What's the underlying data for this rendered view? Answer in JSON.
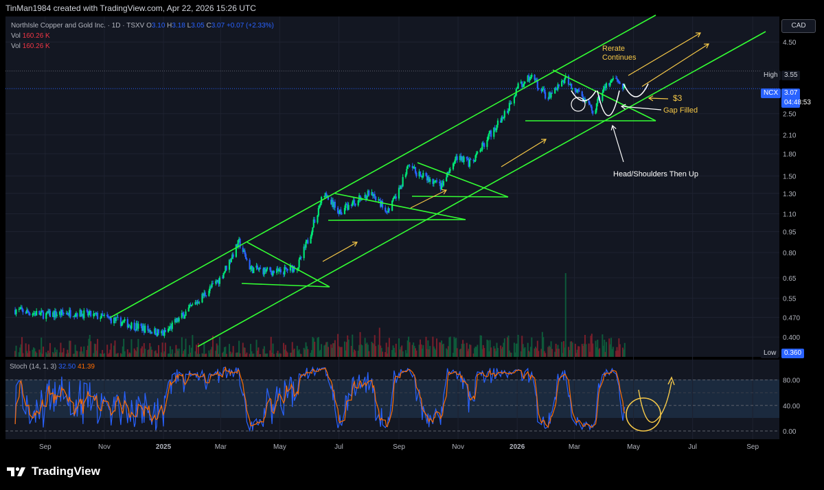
{
  "header": {
    "credit": "TinMan1984 created with TradingView.com, Apr 22, 2026 15:26 UTC"
  },
  "legend": {
    "symbol_line": "NorthIsle Copper and Gold Inc. · 1D · TSXV",
    "o_label": "O",
    "o_value": "3.10",
    "h_label": "H",
    "h_value": "3.18",
    "l_label": "L",
    "l_value": "3.05",
    "c_label": "C",
    "c_value": "3.07",
    "change": "+0.07 (+2.33%)",
    "vol1_label": "Vol",
    "vol1_value": "160.26 K",
    "vol2_label": "Vol",
    "vol2_value": "160.26 K"
  },
  "price_axis": {
    "currency": "CAD",
    "high_label": "High",
    "high_value": "3.55",
    "symbol_tag": "NCX",
    "last_value": "3.07",
    "countdown": "04:48:53",
    "low_label": "Low",
    "low_value": "0.360"
  },
  "stoch_legend": {
    "name": "Stoch (14, 1, 3)",
    "k_value": "32.50",
    "d_value": "41.39"
  },
  "annotations": {
    "rerate": "Rerate",
    "continues": "Continues",
    "three": "$3",
    "gap_filled": "Gap Filled",
    "hs": "Head/Shoulders Then Up"
  },
  "colors": {
    "up": "#00e676",
    "down": "#2962ff",
    "channel": "#33ff33",
    "stoch_k": "#2962ff",
    "stoch_d": "#ff6d00",
    "arrow": "#f7c948"
  },
  "logo": {
    "text": "TradingView"
  },
  "chart_data": [
    {
      "type": "candlestick",
      "title": "NorthIsle Copper and Gold Inc. · 1D · TSXV",
      "y_scale": "log",
      "y_ticks": [
        "4.50",
        "3.55",
        "3.07",
        "2.50",
        "2.10",
        "1.80",
        "1.50",
        "1.30",
        "1.10",
        "0.95",
        "0.80",
        "0.65",
        "0.55",
        "0.470",
        "0.400",
        "0.360"
      ],
      "x_ticks": [
        "Sep",
        "Nov",
        "2025",
        "Mar",
        "May",
        "Jul",
        "Sep",
        "Nov",
        "2026",
        "Mar",
        "May",
        "Jul",
        "Sep"
      ],
      "approx_close_path": [
        {
          "x": "2024-08-01",
          "y": 0.5
        },
        {
          "x": "2024-09-01",
          "y": 0.48
        },
        {
          "x": "2024-10-01",
          "y": 0.49
        },
        {
          "x": "2024-11-01",
          "y": 0.47
        },
        {
          "x": "2024-12-01",
          "y": 0.44
        },
        {
          "x": "2025-01-01",
          "y": 0.41
        },
        {
          "x": "2025-02-01",
          "y": 0.52
        },
        {
          "x": "2025-03-01",
          "y": 0.65
        },
        {
          "x": "2025-03-20",
          "y": 0.87
        },
        {
          "x": "2025-04-01",
          "y": 0.7
        },
        {
          "x": "2025-05-01",
          "y": 0.68
        },
        {
          "x": "2025-05-20",
          "y": 0.72
        },
        {
          "x": "2025-06-01",
          "y": 0.92
        },
        {
          "x": "2025-06-15",
          "y": 1.3
        },
        {
          "x": "2025-07-01",
          "y": 1.12
        },
        {
          "x": "2025-08-01",
          "y": 1.3
        },
        {
          "x": "2025-08-20",
          "y": 1.13
        },
        {
          "x": "2025-09-01",
          "y": 1.32
        },
        {
          "x": "2025-09-10",
          "y": 1.62
        },
        {
          "x": "2025-10-01",
          "y": 1.45
        },
        {
          "x": "2025-10-15",
          "y": 1.38
        },
        {
          "x": "2025-11-01",
          "y": 1.78
        },
        {
          "x": "2025-11-15",
          "y": 1.65
        },
        {
          "x": "2025-12-01",
          "y": 2.05
        },
        {
          "x": "2025-12-20",
          "y": 2.5
        },
        {
          "x": "2026-01-01",
          "y": 3.1
        },
        {
          "x": "2026-01-15",
          "y": 3.4
        },
        {
          "x": "2026-02-01",
          "y": 2.85
        },
        {
          "x": "2026-02-20",
          "y": 3.3
        },
        {
          "x": "2026-03-10",
          "y": 2.85
        },
        {
          "x": "2026-03-20",
          "y": 2.5
        },
        {
          "x": "2026-04-01",
          "y": 3.1
        },
        {
          "x": "2026-04-15",
          "y": 3.35
        },
        {
          "x": "2026-04-22",
          "y": 3.07
        }
      ],
      "last": {
        "open": 3.1,
        "high": 3.18,
        "low": 3.05,
        "close": 3.07,
        "change": 0.07,
        "change_pct": 2.33
      },
      "range": {
        "high": 3.55,
        "low": 0.36
      }
    },
    {
      "type": "line",
      "title": "Stoch (14, 1, 3)",
      "y_ticks": [
        "80.00",
        "40.00",
        "0.00"
      ],
      "ylim": [
        0,
        100
      ],
      "series": [
        {
          "name": "K",
          "last": 32.5
        },
        {
          "name": "D",
          "last": 41.39
        }
      ]
    }
  ]
}
